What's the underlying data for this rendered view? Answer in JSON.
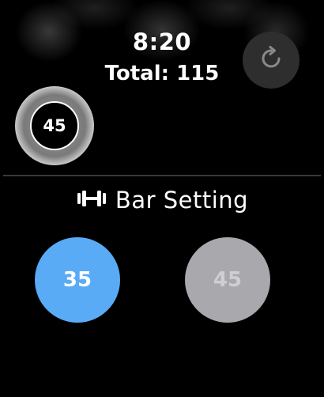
{
  "status": {
    "time": "8:20",
    "total": "Total: 115"
  },
  "toolbar": {
    "reset_icon": "arrow-clockwise-icon"
  },
  "current_plate": {
    "value": "45"
  },
  "bar_setting": {
    "icon": "dumbbell-icon",
    "title": "Bar Setting",
    "options": [
      {
        "label": "35",
        "selected": true,
        "color": "#5aabf6"
      },
      {
        "label": "45",
        "selected": false,
        "color": "#a9a9ad"
      }
    ]
  }
}
